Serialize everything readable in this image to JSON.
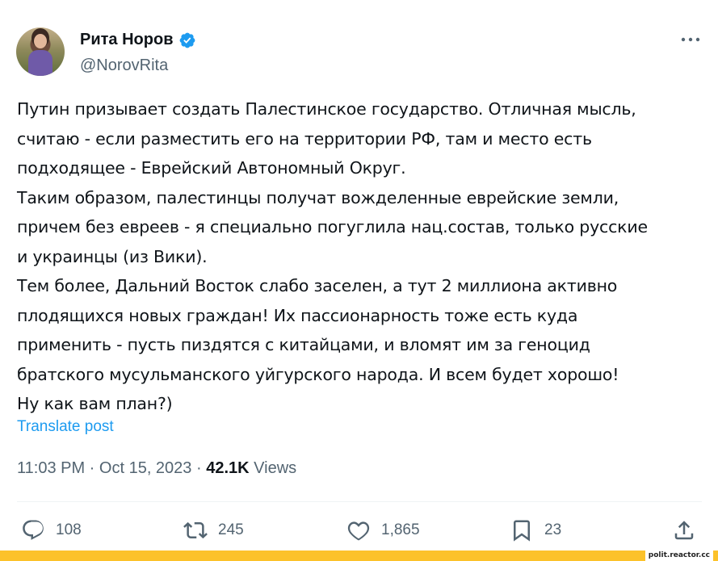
{
  "author": {
    "display_name": "Рита Норов",
    "handle": "@NorovRita",
    "verified": true,
    "verified_color": "#1d9bf0"
  },
  "tweet": {
    "lines": [
      "Путин призывает создать Палестинское государство. Отличная мысль,",
      "считаю - если разместить его на территории РФ, там и место есть",
      "подходящее - Еврейский Автономный Округ.",
      "Таким образом, палестинцы получат вожделенные еврейские земли,",
      "причем без евреев - я специально погуглила нац.состав, только русские",
      "и украинцы (из Вики).",
      "Тем более, Дальний Восток слабо заселен, а тут 2 миллиона активно",
      "плодящихся новых граждан! Их пассионарность тоже есть куда",
      "применить - пусть пиздятся с китайцами, и вломят им за геноцид",
      "братского мусульманского уйгурского народа. И всем будет хорошо!",
      "Ну как вам план?)"
    ],
    "translate_label": "Translate post"
  },
  "meta": {
    "time": "11:03 PM",
    "sep1": " · ",
    "date": "Oct 15, 2023",
    "sep2": " · ",
    "views_count": "42.1K",
    "views_label": " Views"
  },
  "actions": {
    "replies": "108",
    "reposts": "245",
    "likes": "1,865",
    "bookmarks": "23"
  },
  "icons": {
    "more": "more-icon",
    "reply": "reply-icon",
    "repost": "repost-icon",
    "like": "like-icon",
    "bookmark": "bookmark-icon",
    "share": "share-icon"
  },
  "footer": {
    "brand": "polit.reactor.cc",
    "bar_color": "#fcc22a"
  }
}
